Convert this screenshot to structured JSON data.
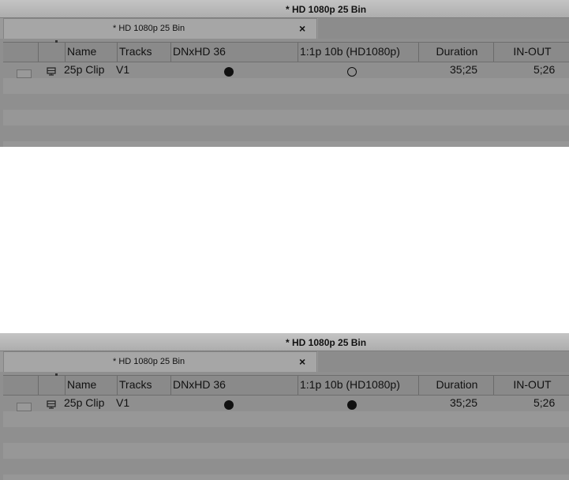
{
  "window_title": "* HD 1080p 25 Bin",
  "tab": {
    "label": "* HD 1080p 25 Bin",
    "close": "×"
  },
  "columns": [
    "",
    "",
    "Name",
    "Tracks",
    "DNxHD 36",
    "1:1p 10b (HD1080p)",
    "Duration",
    "IN-OUT"
  ],
  "panels": [
    {
      "rows": [
        {
          "name": "25p Clip",
          "tracks": "V1",
          "dnxhd36": "filled",
          "uncompressed": "empty",
          "duration": "35;25",
          "in_out": "5;26"
        }
      ]
    },
    {
      "rows": [
        {
          "name": "25p Clip",
          "tracks": "V1",
          "dnxhd36": "filled",
          "uncompressed": "filled",
          "duration": "35;25",
          "in_out": "5;26"
        }
      ]
    }
  ]
}
